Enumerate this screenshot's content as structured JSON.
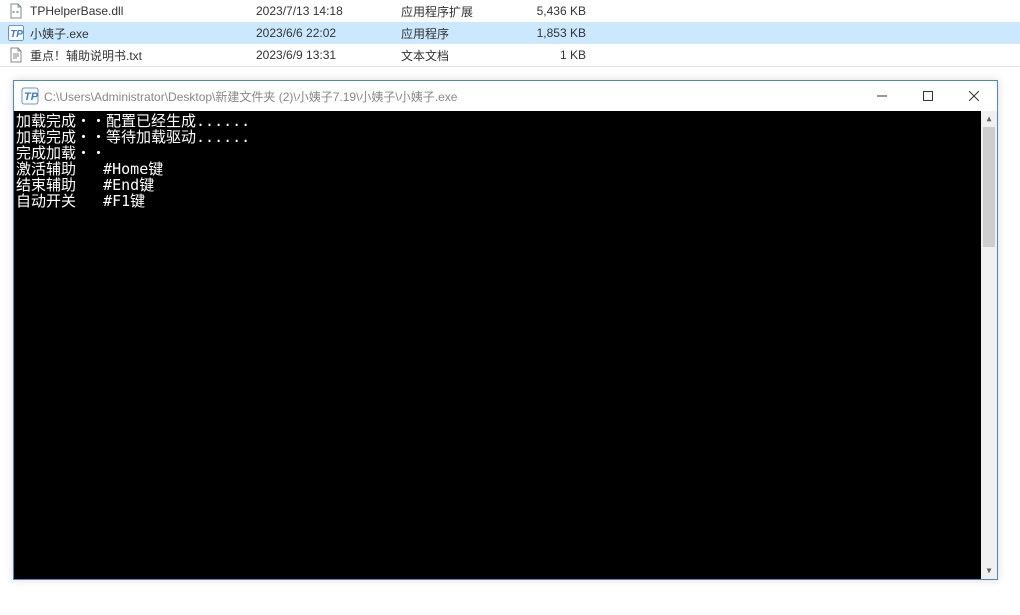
{
  "files": [
    {
      "name": "TPHelperBase.dll",
      "date": "2023/7/13 14:18",
      "type": "应用程序扩展",
      "size": "5,436 KB",
      "icon": "dll"
    },
    {
      "name": "小姨子.exe",
      "date": "2023/6/6 22:02",
      "type": "应用程序",
      "size": "1,853 KB",
      "icon": "tp",
      "selected": true
    },
    {
      "name": "重点！辅助说明书.txt",
      "date": "2023/6/9 13:31",
      "type": "文本文档",
      "size": "1 KB",
      "icon": "txt"
    }
  ],
  "console": {
    "title": "C:\\Users\\Administrator\\Desktop\\新建文件夹 (2)\\小姨子7.19\\小姨子\\小姨子.exe",
    "lines": [
      "加载完成・・配置已经生成......",
      "加载完成・・等待加载驱动......",
      "完成加载・・",
      "激活辅助   #Home键",
      "结束辅助   #End键",
      "自动开关   #F1键"
    ]
  },
  "window_controls": {
    "minimize": "—",
    "maximize": "☐",
    "close": "✕"
  }
}
